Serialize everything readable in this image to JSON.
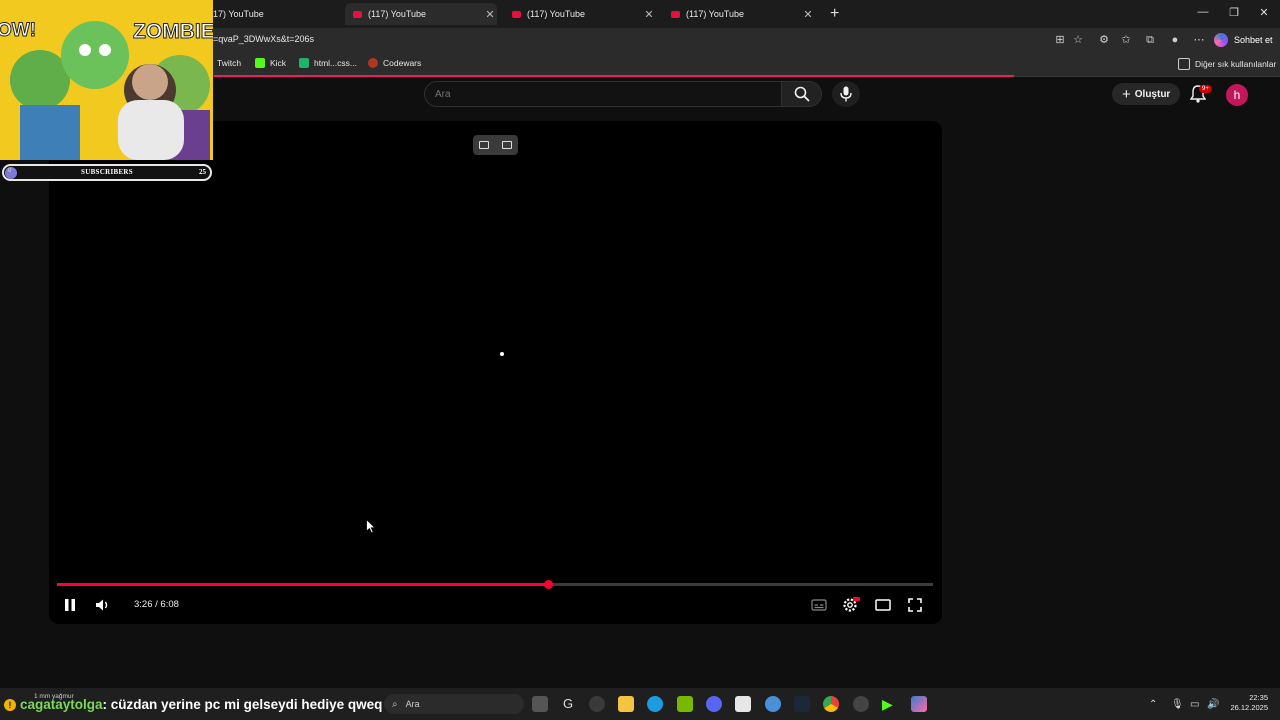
{
  "browser": {
    "tabs": [
      {
        "title": "17) YouTube",
        "active": false
      },
      {
        "title": "(117) YouTube",
        "active": true
      },
      {
        "title": "(117) YouTube",
        "active": false
      },
      {
        "title": "(117) YouTube",
        "active": false
      }
    ],
    "new_tab": "+",
    "url": "=qvaP_3DWwXs&t=206s",
    "copilot_label": "Sohbet et",
    "bookmarks": [
      {
        "label": "Twitch"
      },
      {
        "label": "Kick"
      },
      {
        "label": "html...css..."
      },
      {
        "label": "Codewars"
      }
    ],
    "other_bookmarks": "Diğer sık kullanılanlar"
  },
  "youtube": {
    "search_placeholder": "Ara",
    "create_label": "Oluştur",
    "notification_badge": "9+",
    "avatar_letter": "h"
  },
  "player": {
    "time": "3:26 / 6:08",
    "progress": 0.56
  },
  "overlay": {
    "subscribers_label": "SUBSCRIBERS",
    "subscribers_start": "0",
    "subscribers_count": "25",
    "webcam_text": "ZOMBIE!",
    "webcam_text2": "OW!"
  },
  "taskbar": {
    "chat_user": "cagataytolga",
    "chat_message": ": cüzdan yerine pc mi gelseydi hediye qweq",
    "weather": "1 mm yağmur",
    "search_placeholder": "Ara",
    "time": "22:35",
    "date": "26.12.2025"
  },
  "colors": {
    "accent": "#ff0033",
    "avatar": "#c2185b",
    "bg": "#0f0f0f"
  }
}
